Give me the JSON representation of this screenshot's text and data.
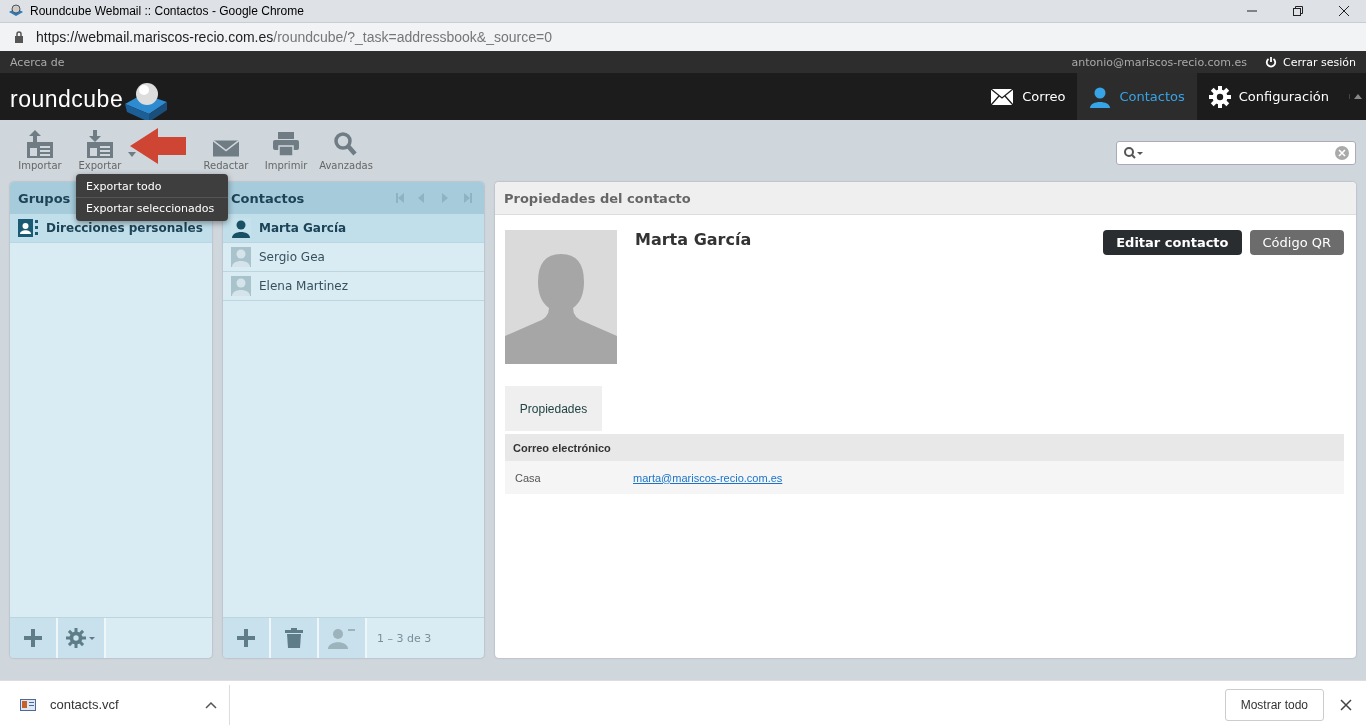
{
  "browser": {
    "title": "Roundcube Webmail :: Contactos - Google Chrome",
    "url_host": "https://webmail.mariscos-recio.com.es",
    "url_path": "/roundcube/?_task=addressbook&_source=0"
  },
  "topbar": {
    "about": "Acerca de",
    "user": "antonio@mariscos-recio.com.es",
    "logout": "Cerrar sesión"
  },
  "logo": "roundcube",
  "nav": [
    {
      "label": "Correo",
      "kind": "mail",
      "selected": false
    },
    {
      "label": "Contactos",
      "kind": "person",
      "selected": true
    },
    {
      "label": "Configuración",
      "kind": "gear",
      "selected": false
    }
  ],
  "toolbar": [
    {
      "label": "Importar",
      "kind": "import"
    },
    {
      "label": "Exportar",
      "kind": "export"
    },
    {
      "label": "Redactar",
      "kind": "compose"
    },
    {
      "label": "Imprimir",
      "kind": "print"
    },
    {
      "label": "Avanzadas",
      "kind": "search"
    }
  ],
  "export_menu": [
    "Exportar todo",
    "Exportar seleccionados"
  ],
  "groups": {
    "title": "Grupos",
    "items": [
      {
        "label": "Direcciones personales",
        "selected": true
      }
    ]
  },
  "contacts": {
    "title": "Contactos",
    "items": [
      {
        "name": "Marta García",
        "selected": true
      },
      {
        "name": "Sergio Gea",
        "selected": false
      },
      {
        "name": "Elena Martinez",
        "selected": false
      }
    ],
    "count": "1 – 3 de 3"
  },
  "details": {
    "title": "Propiedades del contacto",
    "name": "Marta García",
    "edit": "Editar contacto",
    "qr": "Código QR",
    "tab": "Propiedades",
    "section": "Correo electrónico",
    "field_label": "Casa",
    "field_value": "marta@mariscos-recio.com.es"
  },
  "download": {
    "file": "contacts.vcf",
    "show_all": "Mostrar todo"
  }
}
